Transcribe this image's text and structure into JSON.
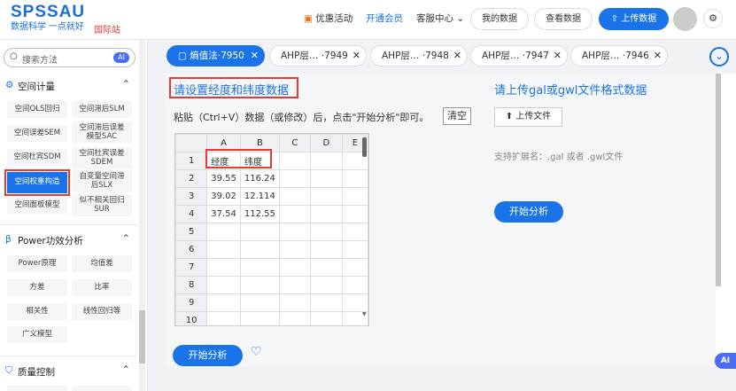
{
  "header": {
    "logo_title": "SPSSAU",
    "logo_subtitle": "数据科学 一点就好",
    "intl": "国际站",
    "promo": "优惠活动",
    "member": "开通会员",
    "service": "客服中心",
    "my_data": "我的数据",
    "view_data": "查看数据",
    "upload": "上传数据"
  },
  "sidebar": {
    "search_placeholder": "搜索方法",
    "ai_badge": "AI",
    "sections": [
      {
        "title": "空间计量",
        "items": [
          "空间OLS回归",
          "空间滞后SLM",
          "空间误差SEM",
          "空间滞后误差模型SAC",
          "空间杜宾SDM",
          "空间杜宾误差SDEM",
          "空间权重构造",
          "自变量空间滞后SLX",
          "空间面板模型",
          "似不相关回归SUR"
        ]
      },
      {
        "title": "Power功效分析",
        "items": [
          "Power原理",
          "均值差",
          "方差",
          "比率",
          "相关性",
          "线性回归等",
          "广义模型"
        ]
      },
      {
        "title": "质量控制",
        "items": []
      }
    ]
  },
  "tabs": [
    {
      "label": "熵值法",
      "id": "·7950"
    },
    {
      "label": "AHP层…",
      "id": "·7949"
    },
    {
      "label": "AHP层…",
      "id": "·7948"
    },
    {
      "label": "AHP层…",
      "id": "·7947"
    },
    {
      "label": "AHP层…",
      "id": "·7946"
    }
  ],
  "main": {
    "title_left": "请设置经度和纬度数据",
    "paste_hint": "粘贴（Ctrl+V）数据（或修改）后，点击\"开始分析\"即可。",
    "clear": "清空",
    "title_right": "请上传gal或gwl文件格式数据",
    "upload_file": "上传文件",
    "ext_hint": "支持扩展名：.gal 或者 .gwl文件",
    "start_right": "开始分析",
    "start_bottom": "开始分析"
  },
  "sheet": {
    "cols": [
      "A",
      "B",
      "C",
      "D",
      "E"
    ],
    "rows": [
      [
        "经度",
        "纬度",
        "",
        "",
        ""
      ],
      [
        "39.55",
        "116.24",
        "",
        "",
        ""
      ],
      [
        "39.02",
        "12.114",
        "",
        "",
        ""
      ],
      [
        "37.54",
        "112.55",
        "",
        "",
        ""
      ],
      [
        "",
        "",
        "",
        "",
        ""
      ],
      [
        "",
        "",
        "",
        "",
        ""
      ],
      [
        "",
        "",
        "",
        "",
        ""
      ],
      [
        "",
        "",
        "",
        "",
        ""
      ],
      [
        "",
        "",
        "",
        "",
        ""
      ],
      [
        "",
        "",
        "",
        "",
        ""
      ]
    ]
  },
  "ai_float": "AI",
  "colors": {
    "accent": "#1a73e8",
    "highlight": "#e53935"
  }
}
